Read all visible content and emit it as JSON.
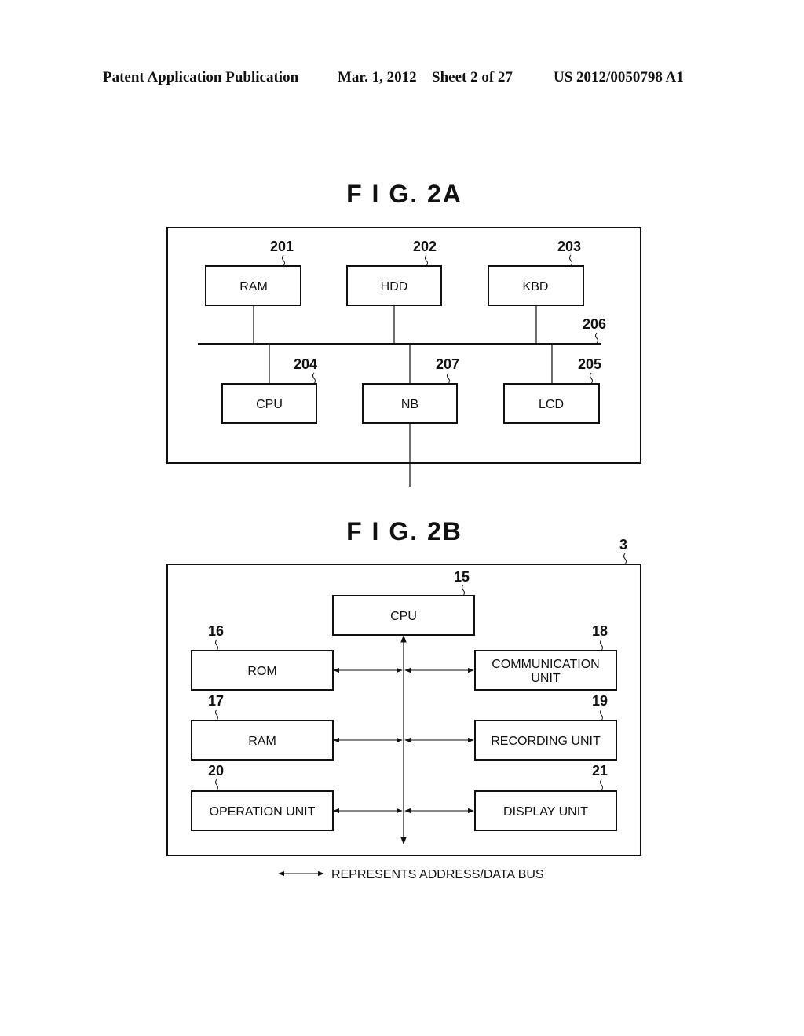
{
  "header": {
    "publication": "Patent Application Publication",
    "date": "Mar. 1, 2012",
    "sheet": "Sheet 2 of 27",
    "doc_number": "US 2012/0050798 A1"
  },
  "fig2a": {
    "title": "F I G.  2A",
    "bus_ref": "206",
    "blocks": [
      {
        "ref": "201",
        "label": "RAM"
      },
      {
        "ref": "202",
        "label": "HDD"
      },
      {
        "ref": "203",
        "label": "KBD"
      },
      {
        "ref": "204",
        "label": "CPU"
      },
      {
        "ref": "207",
        "label": "NB"
      },
      {
        "ref": "205",
        "label": "LCD"
      }
    ]
  },
  "fig2b": {
    "title": "F I G.  2B",
    "device_ref": "3",
    "blocks": [
      {
        "ref": "15",
        "label": "CPU"
      },
      {
        "ref": "16",
        "label": "ROM"
      },
      {
        "ref": "18",
        "label_lines": [
          "COMMUNICATION",
          "UNIT"
        ]
      },
      {
        "ref": "17",
        "label": "RAM"
      },
      {
        "ref": "19",
        "label": "RECORDING UNIT"
      },
      {
        "ref": "20",
        "label": "OPERATION UNIT"
      },
      {
        "ref": "21",
        "label": "DISPLAY UNIT"
      }
    ],
    "legend": "REPRESENTS ADDRESS/DATA BUS"
  }
}
